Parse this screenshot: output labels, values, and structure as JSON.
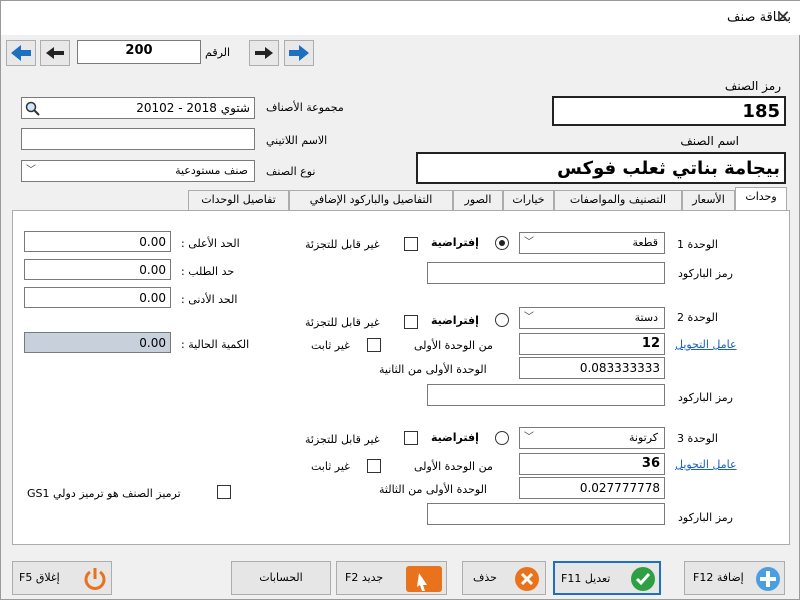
{
  "window": {
    "title": "بطاقة صنف",
    "close": "✕"
  },
  "nav": {
    "number_label": "الرقم",
    "number_value": "200"
  },
  "form": {
    "code_label": "رمز الصنف",
    "code_value": "185",
    "name_label": "اسم الصنف",
    "name_value": "بيجامة بناتي ثعلب فوكس",
    "group_label": "مجموعة الأصناف",
    "group_value": "20102 - شتوي 2018",
    "latin_label": "الاسم اللاتيني",
    "latin_value": "",
    "type_label": "نوع الصنف",
    "type_value": "صنف مستودعية"
  },
  "tabs": [
    {
      "label": "وحدات"
    },
    {
      "label": "الأسعار"
    },
    {
      "label": "التصنيف والمواصفات"
    },
    {
      "label": "خيارات"
    },
    {
      "label": "الصور"
    },
    {
      "label": "التفاصيل والباركود الإضافي"
    },
    {
      "label": "تفاصيل الوحدات"
    }
  ],
  "units": {
    "unit1": {
      "label": "الوحدة 1",
      "value": "قطعة",
      "default_label": "إفتراضية",
      "indivisible_label": "غير قابل للتجزئة",
      "barcode_label": "رمز الباركود"
    },
    "unit2": {
      "label": "الوحدة 2",
      "value": "دستة",
      "default_label": "إفتراضية",
      "indivisible_label": "غير قابل للتجزئة",
      "factor_link": "عامل التحويل",
      "from_first_label": "من الوحدة الأولى",
      "from_first_value": "12",
      "not_fixed_label": "غير ثابت",
      "first_from_label": "الوحدة الأولى من الثانية",
      "first_from_value": "0.083333333",
      "barcode_label": "رمز الباركود"
    },
    "unit3": {
      "label": "الوحدة 3",
      "value": "كرتونة",
      "default_label": "إفتراضية",
      "indivisible_label": "غير قابل للتجزئة",
      "factor_link": "عامل التحويل",
      "from_first_label": "من الوحدة الأولى",
      "from_first_value": "36",
      "not_fixed_label": "غير ثابت",
      "first_from_label": "الوحدة الأولى من الثالثة",
      "first_from_value": "0.027777778",
      "barcode_label": "رمز الباركود"
    }
  },
  "limits": {
    "max_label": "الحد الأعلى :",
    "max_value": "0.00",
    "order_label": "حد الطلب :",
    "order_value": "0.00",
    "min_label": "الحد الأدنى :",
    "min_value": "0.00",
    "qty_label": "الكمية الحالية :",
    "qty_value": "0.00",
    "gs1_label": "ترميز الصنف هو ترميز دولي GS1"
  },
  "buttons": {
    "add": "إضافة F12",
    "edit": "تعديل F11",
    "delete": "حذف",
    "new": "جديد F2",
    "accounts": "الحسابات",
    "close": "إغلاق F5"
  },
  "colors": {
    "arrow_blue": "#1e6fbf",
    "check_green": "#2ea043",
    "delete_red": "#d9534f",
    "new_orange": "#e8731c",
    "close_orange": "#e8731c"
  }
}
